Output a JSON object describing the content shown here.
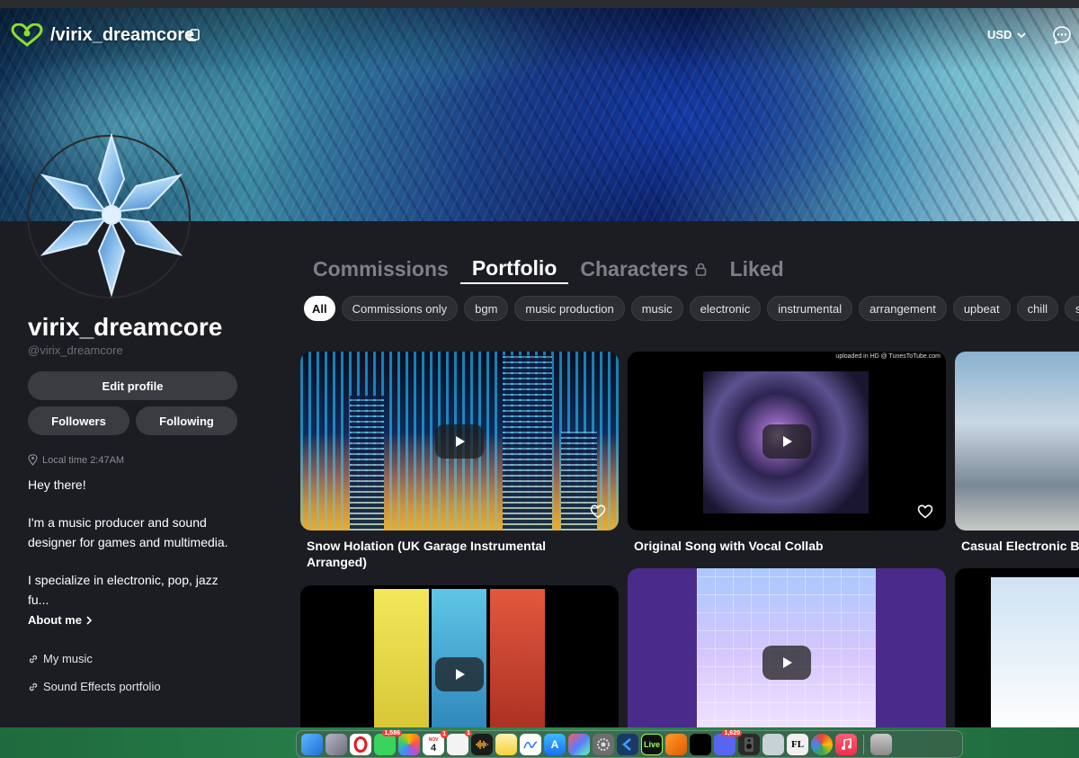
{
  "header": {
    "handle_title": "/virix_dreamcore",
    "currency": "USD"
  },
  "profile": {
    "name": "virix_dreamcore",
    "handle": "@virix_dreamcore",
    "edit_label": "Edit profile",
    "followers_label": "Followers",
    "following_label": "Following",
    "local_time": "Local time 2:47AM",
    "bio": [
      "Hey there!",
      "I'm a music producer and sound designer for games and multimedia.",
      "I specialize in electronic, pop, jazz fu..."
    ],
    "about_label": "About me",
    "links": [
      "My music",
      "Sound Effects portfolio"
    ]
  },
  "tabs": [
    {
      "label": "Commissions",
      "active": false
    },
    {
      "label": "Portfolio",
      "active": true
    },
    {
      "label": "Characters",
      "active": false,
      "locked": true
    },
    {
      "label": "Liked",
      "active": false
    }
  ],
  "filters": [
    "All",
    "Commissions only",
    "bgm",
    "music production",
    "music",
    "electronic",
    "instrumental",
    "arrangement",
    "upbeat",
    "chill",
    "stri"
  ],
  "cards": [
    {
      "title": "Snow Holation (UK Garage Instrumental Arranged)"
    },
    {
      "title": "Original Song with Vocal Collab",
      "overlay_text": "uploaded in HD @ TunesToTube.com"
    },
    {
      "title": "Casual Electronic B"
    }
  ],
  "dock": {
    "badges": [
      "1,586",
      "1",
      "1",
      "1,620"
    ],
    "calendar": {
      "month": "NOV",
      "day": "4"
    },
    "live_label": "Live"
  }
}
